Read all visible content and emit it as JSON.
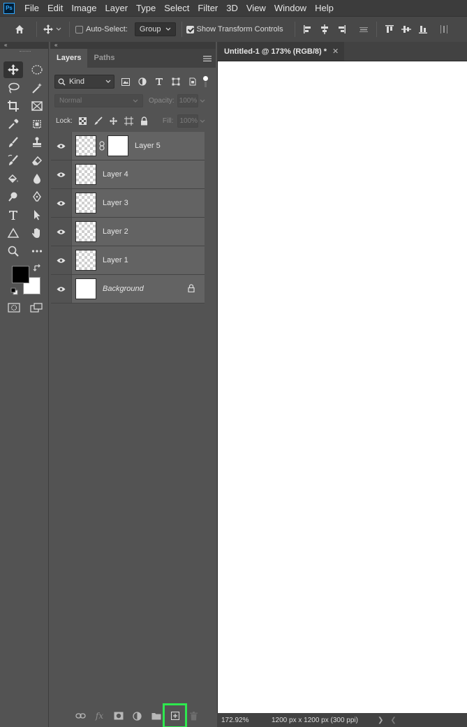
{
  "app": {
    "logo_text": "Ps"
  },
  "menubar": {
    "items": [
      "File",
      "Edit",
      "Image",
      "Layer",
      "Type",
      "Select",
      "Filter",
      "3D",
      "View",
      "Window",
      "Help"
    ]
  },
  "options": {
    "auto_select_label": "Auto-Select:",
    "auto_select_checked": false,
    "target_value": "Group",
    "show_transform_label": "Show Transform Controls",
    "show_transform_checked": true
  },
  "panel": {
    "tabs": [
      {
        "label": "Layers",
        "active": true
      },
      {
        "label": "Paths",
        "active": false
      }
    ],
    "filter_kind": "Kind",
    "blend_mode": "Normal",
    "opacity_label": "Opacity:",
    "opacity_value": "100%",
    "lock_label": "Lock:",
    "fill_label": "Fill:",
    "fill_value": "100%"
  },
  "layers": [
    {
      "name": "Layer 5",
      "visible": true,
      "has_mask": true,
      "thumb": "checker"
    },
    {
      "name": "Layer 4",
      "visible": true,
      "has_mask": false,
      "thumb": "checker"
    },
    {
      "name": "Layer 3",
      "visible": true,
      "has_mask": false,
      "thumb": "checker"
    },
    {
      "name": "Layer 2",
      "visible": true,
      "has_mask": false,
      "thumb": "checker"
    },
    {
      "name": "Layer 1",
      "visible": true,
      "has_mask": false,
      "thumb": "checker"
    },
    {
      "name": "Background",
      "visible": true,
      "has_mask": false,
      "thumb": "white",
      "locked": true
    }
  ],
  "document": {
    "tab_title": "Untitled-1 @ 173% (RGB/8) *",
    "zoom": "172.92%",
    "dimensions": "1200 px x 1200 px (300 ppi)"
  },
  "colors": {
    "accent_highlight": "#2ee84e",
    "foreground": "#000000",
    "background": "#ffffff"
  }
}
